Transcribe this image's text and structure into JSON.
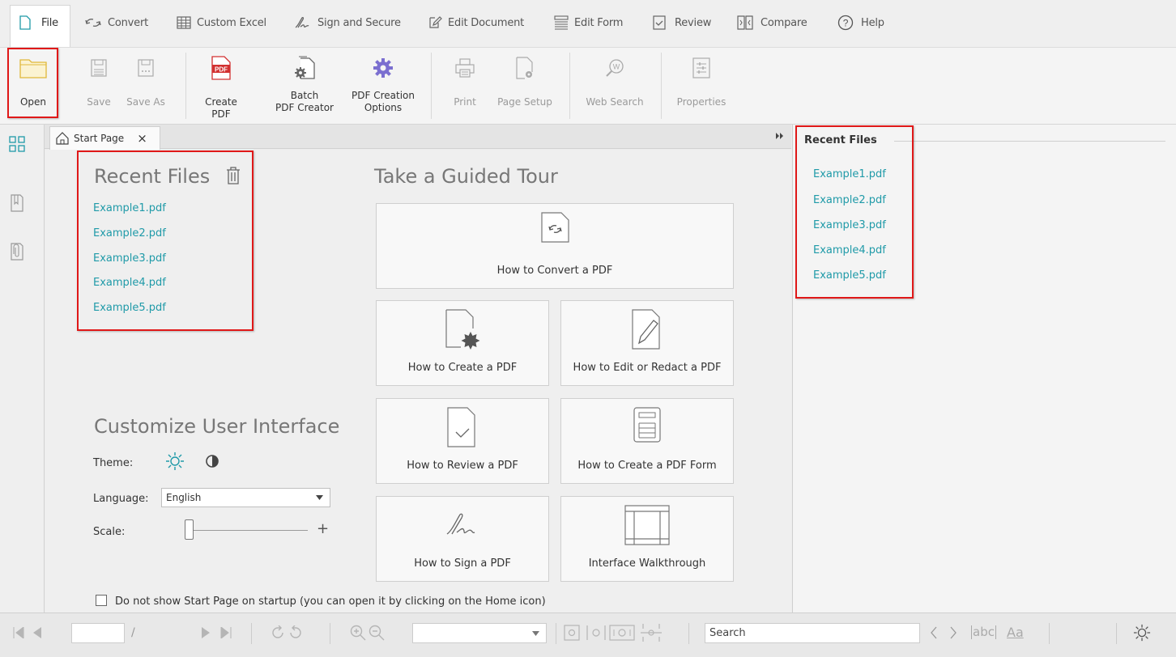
{
  "menu": {
    "file": "File",
    "convert": "Convert",
    "custom_excel": "Custom Excel",
    "sign_secure": "Sign and Secure",
    "edit_document": "Edit Document",
    "edit_form": "Edit Form",
    "review": "Review",
    "compare": "Compare",
    "help": "Help"
  },
  "ribbon": {
    "open": "Open",
    "save": "Save",
    "save_as": "Save As",
    "create_pdf": "Create PDF",
    "batch_line1": "Batch",
    "batch_line2": "PDF Creator",
    "options_line1": "PDF Creation",
    "options_line2": "Options",
    "print": "Print",
    "page_setup": "Page Setup",
    "web_search": "Web Search",
    "properties": "Properties",
    "pdf_badge": "PDF"
  },
  "tab": {
    "label": "Start Page",
    "close": "×"
  },
  "recent": {
    "title": "Recent Files",
    "files": [
      "Example1.pdf",
      "Example2.pdf",
      "Example3.pdf",
      "Example4.pdf",
      "Example5.pdf"
    ]
  },
  "tour": {
    "title": "Take a Guided Tour",
    "convert": "How to Convert a PDF",
    "create": "How to Create a PDF",
    "edit": "How to Edit or Redact a PDF",
    "review": "How to Review a PDF",
    "form": "How to Create a PDF Form",
    "sign": "How to Sign a PDF",
    "walkthrough": "Interface Walkthrough"
  },
  "customize": {
    "title": "Customize User Interface",
    "theme_label": "Theme:",
    "language_label": "Language:",
    "language_value": "English",
    "scale_label": "Scale:",
    "scale_plus": "+"
  },
  "startup": {
    "checkbox_label": "Do not show Start Page on startup (you can open it by clicking on the Home icon)",
    "checked": false
  },
  "right_panel": {
    "title": "Recent Files",
    "files": [
      "Example1.pdf",
      "Example2.pdf",
      "Example3.pdf",
      "Example4.pdf",
      "Example5.pdf"
    ]
  },
  "statusbar": {
    "page_separator": "/",
    "search_placeholder": "Search",
    "abc": "abc",
    "aa": "Aa"
  },
  "colors": {
    "link": "#1f9aa8",
    "highlight": "#e01818",
    "folder": "#e8c84a",
    "gear": "#7b6fd0"
  }
}
